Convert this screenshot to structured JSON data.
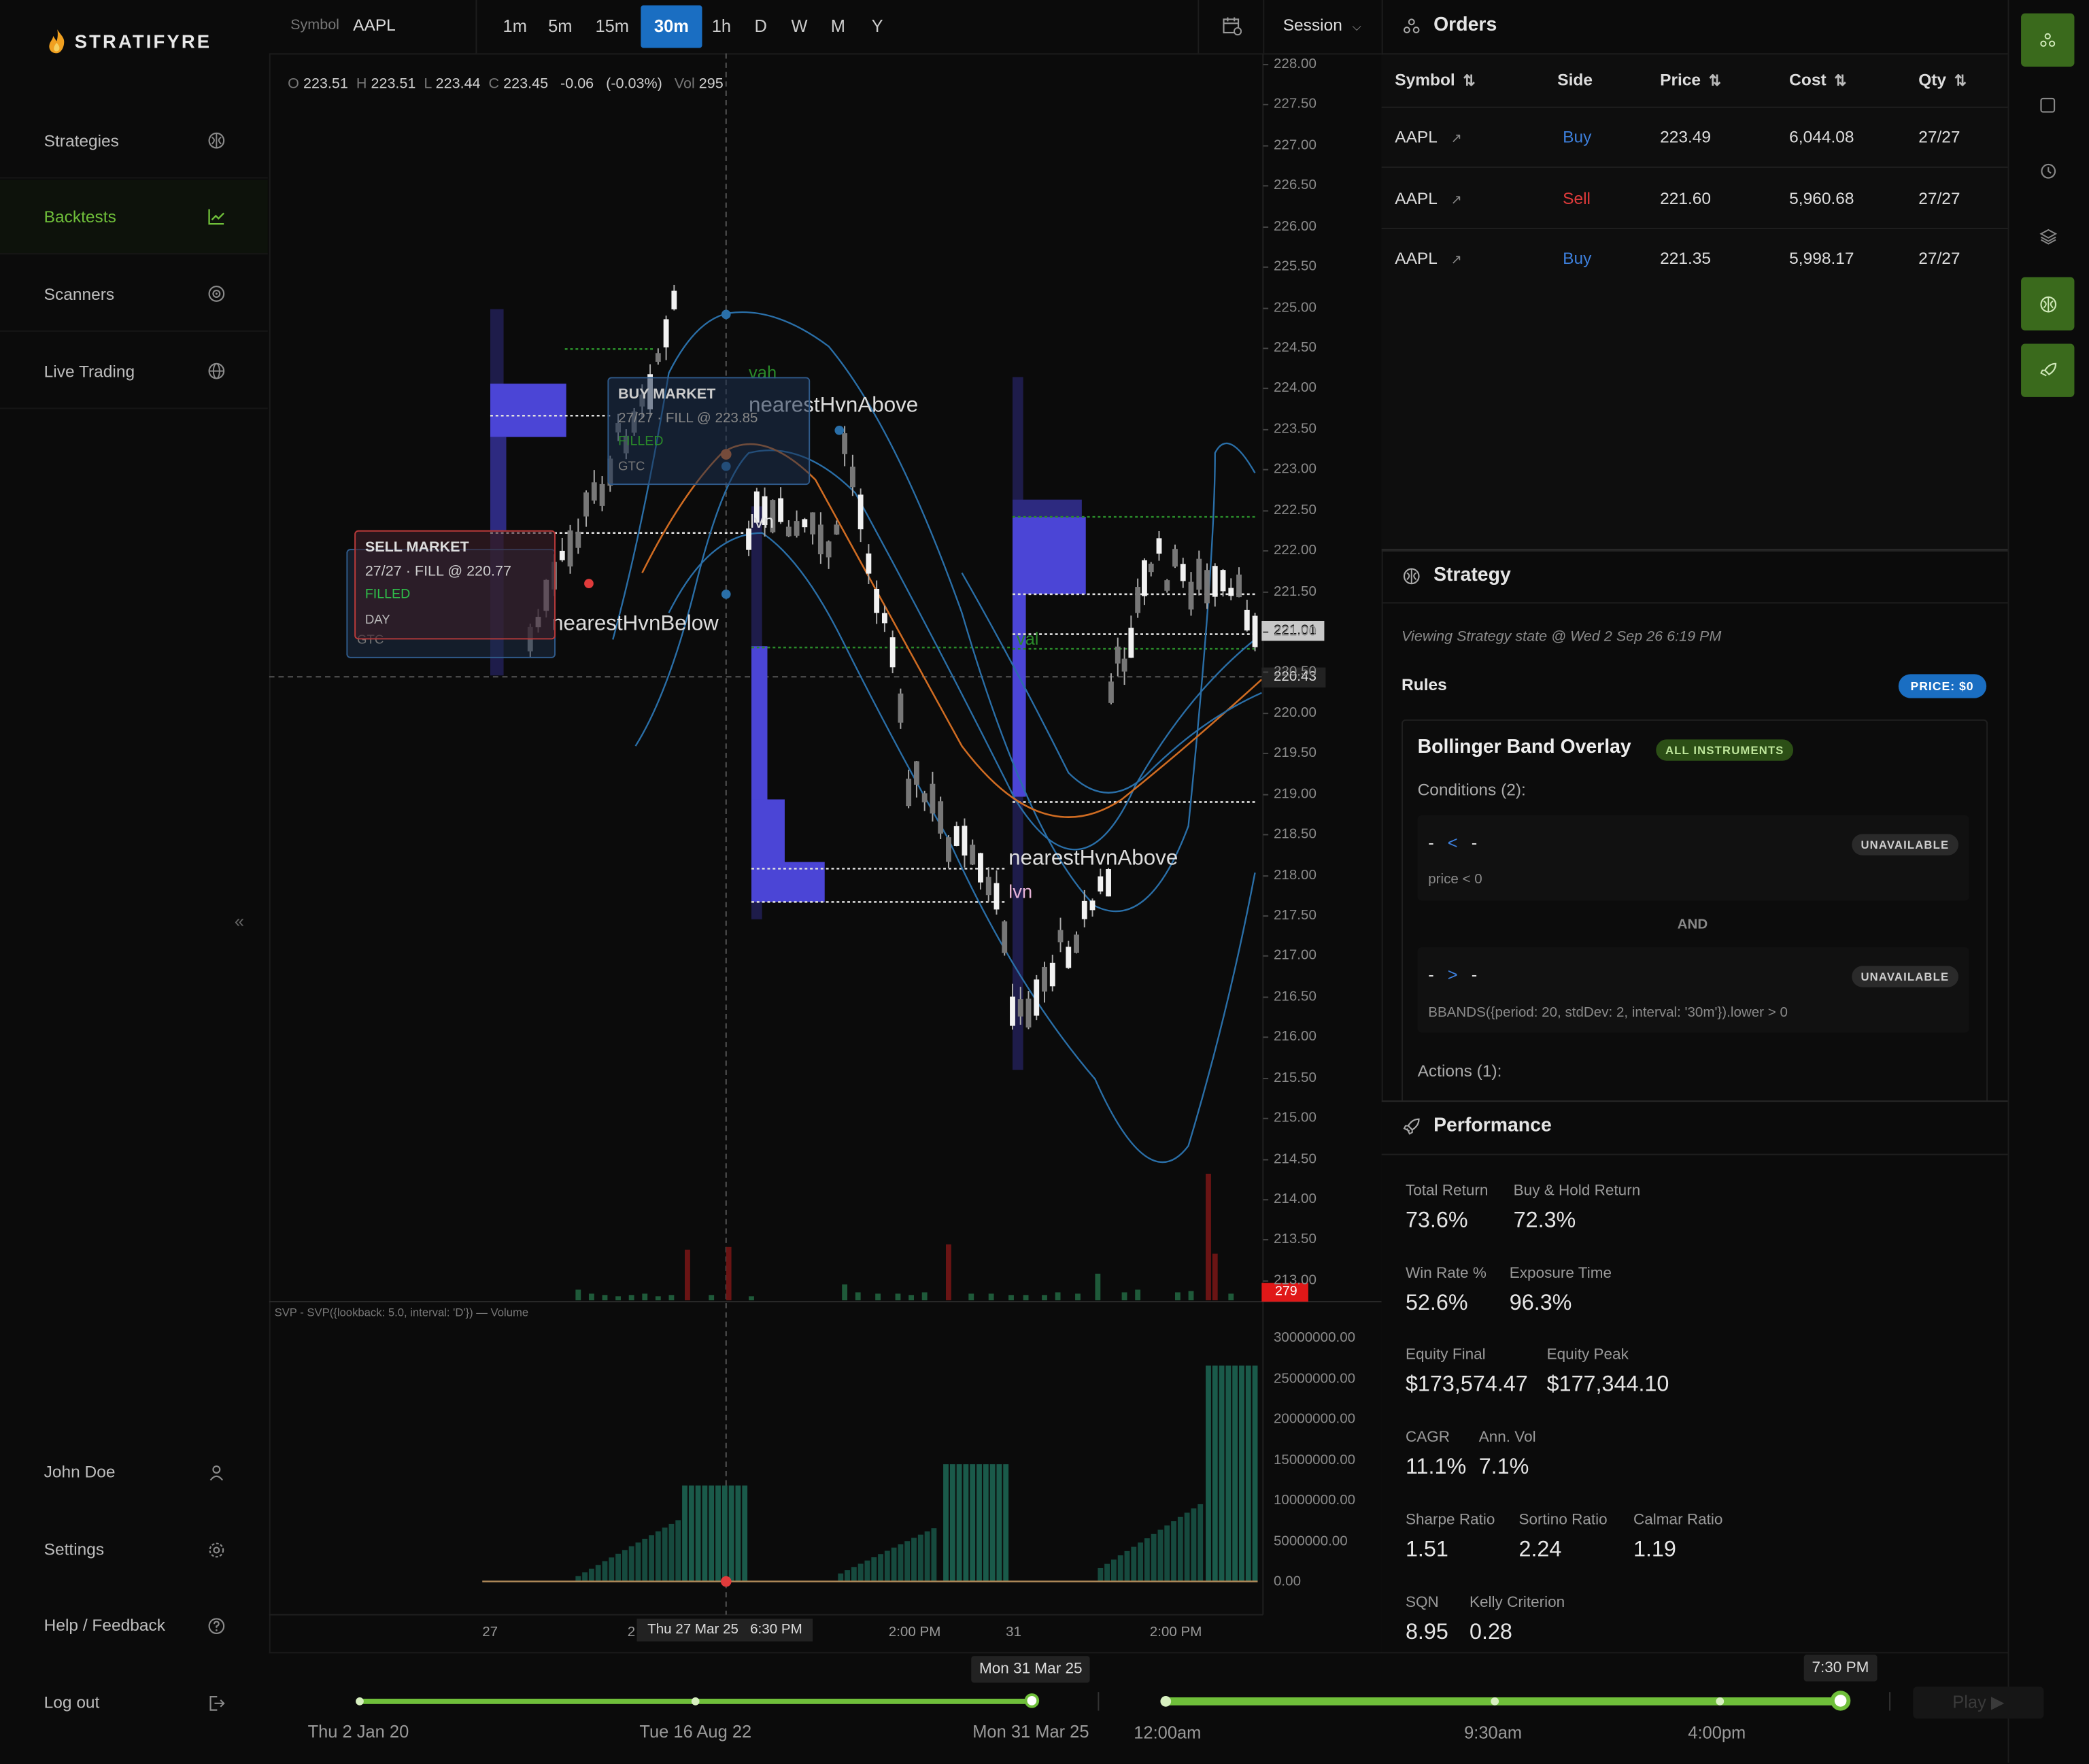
{
  "app": {
    "name": "STRATIFYRE"
  },
  "sidebar": {
    "items": [
      {
        "label": "Strategies",
        "icon": "brain-icon"
      },
      {
        "label": "Backtests",
        "icon": "chart-icon",
        "active": true
      },
      {
        "label": "Scanners",
        "icon": "radar-icon"
      },
      {
        "label": "Live Trading",
        "icon": "globe-icon"
      }
    ],
    "bottom": [
      {
        "label": "John Doe",
        "icon": "user-icon"
      },
      {
        "label": "Settings",
        "icon": "gear-icon"
      },
      {
        "label": "Help / Feedback",
        "icon": "help-icon"
      },
      {
        "label": "Log out",
        "icon": "logout-icon"
      }
    ],
    "collapse_glyph": "«"
  },
  "toolbar": {
    "symbol_label": "Symbol",
    "symbol": "AAPL",
    "timeframes": [
      "1m",
      "5m",
      "15m",
      "30m",
      "1h",
      "D",
      "W",
      "M",
      "Y"
    ],
    "active_timeframe": "30m",
    "session_label": "Session"
  },
  "ohlc": {
    "o": "223.51",
    "h": "223.51",
    "l": "223.44",
    "c": "223.45",
    "change": "-0.06",
    "change_pct": "(-0.03%)",
    "vol": "295"
  },
  "chart": {
    "price_ticks": [
      "228.00",
      "227.50",
      "227.00",
      "226.50",
      "226.00",
      "225.50",
      "225.00",
      "224.50",
      "224.00",
      "223.50",
      "223.00",
      "222.50",
      "222.00",
      "221.50",
      "221.00",
      "220.50",
      "220.00",
      "219.50",
      "219.00",
      "218.50",
      "218.00",
      "217.50",
      "217.00",
      "216.50",
      "216.00",
      "215.50",
      "215.00",
      "214.50",
      "214.00",
      "213.50",
      "213.00"
    ],
    "last_price_tag": "221.01",
    "crosshair_price": "220.43",
    "volume_tag": "279",
    "labels": {
      "vah": "vah",
      "nearest_above": "nearestHvnAbove",
      "nearest_below": "nearestHvnBelow",
      "lvn": "lvn",
      "val": "val"
    },
    "buy_order": {
      "title": "BUY MARKET",
      "fill": "27/27 · FILL @ 223.85",
      "status": "FILLED",
      "tif": "GTC"
    },
    "sell_order": {
      "title": "SELL MARKET",
      "fill": "27/27 · FILL @ 220.77",
      "status": "FILLED",
      "tif": "DAY",
      "tif2": "GTC"
    },
    "indicator_title": "SVP - SVP({lookback: 5.0, interval: 'D'}) — Volume",
    "volume_ticks": [
      "30000000.00",
      "25000000.00",
      "20000000.00",
      "15000000.00",
      "10000000.00",
      "5000000.00",
      "0.00"
    ],
    "x_labels": [
      "27",
      "2",
      "2:00 PM",
      "31",
      "2:00 PM"
    ],
    "crosshair_time": "Thu 27 Mar 25   6:30 PM"
  },
  "orders": {
    "title": "Orders",
    "columns": [
      "Symbol",
      "Side",
      "Price",
      "Cost",
      "Qty"
    ],
    "rows": [
      {
        "symbol": "AAPL",
        "side": "Buy",
        "price": "223.49",
        "cost": "6,044.08",
        "qty": "27/27"
      },
      {
        "symbol": "AAPL",
        "side": "Sell",
        "price": "221.60",
        "cost": "5,960.68",
        "qty": "27/27"
      },
      {
        "symbol": "AAPL",
        "side": "Buy",
        "price": "221.35",
        "cost": "5,998.17",
        "qty": "27/27"
      }
    ]
  },
  "strategy": {
    "title": "Strategy",
    "viewing": "Viewing Strategy state @ Wed 2 Sep 26 6:19 PM",
    "rules_label": "Rules",
    "price_badge": "PRICE: $0",
    "rule_name": "Bollinger Band Overlay",
    "scope_badge": "ALL INSTRUMENTS",
    "conditions_label": "Conditions (2):",
    "conditions": [
      {
        "lhs": "-",
        "op": "<",
        "rhs": "-",
        "badge": "UNAVAILABLE",
        "expr": "price < 0"
      },
      {
        "lhs": "-",
        "op": ">",
        "rhs": "-",
        "badge": "UNAVAILABLE",
        "expr": "BBANDS({period: 20, stdDev: 2, interval: '30m'}).lower > 0"
      }
    ],
    "and_label": "AND",
    "actions_label": "Actions (1):"
  },
  "performance": {
    "title": "Performance",
    "rows": [
      [
        {
          "label": "Total Return",
          "value": "73.6%"
        },
        {
          "label": "Buy & Hold Return",
          "value": "72.3%"
        }
      ],
      [
        {
          "label": "Win Rate %",
          "value": "52.6%"
        },
        {
          "label": "Exposure Time",
          "value": "96.3%"
        }
      ],
      [
        {
          "label": "Equity Final",
          "value": "$173,574.47"
        },
        {
          "label": "Equity Peak",
          "value": "$177,344.10"
        }
      ],
      [
        {
          "label": "CAGR",
          "value": "11.1%"
        },
        {
          "label": "Ann. Vol",
          "value": "7.1%"
        }
      ],
      [
        {
          "label": "Sharpe Ratio",
          "value": "1.51"
        },
        {
          "label": "Sortino Ratio",
          "value": "2.24"
        },
        {
          "label": "Calmar Ratio",
          "value": "1.19"
        }
      ],
      [
        {
          "label": "SQN",
          "value": "8.95"
        },
        {
          "label": "Kelly Criterion",
          "value": "0.28"
        }
      ]
    ]
  },
  "timeline": {
    "date_labels": [
      "Thu 2 Jan 20",
      "Tue 16 Aug 22",
      "Mon 31 Mar 25"
    ],
    "date_tooltip": "Mon 31 Mar 25",
    "date_progress": 1.0,
    "time_labels": [
      "12:00am",
      "9:30am",
      "4:00pm"
    ],
    "time_tooltip": "7:30 PM",
    "time_progress": 1.0,
    "play_label": "Play ▶"
  },
  "colors": {
    "accent_green": "#6fbf3a",
    "blue": "#1a6ec2",
    "buy": "#3d7fdb",
    "sell": "#e03b3b",
    "svp": "#4b45d6"
  }
}
